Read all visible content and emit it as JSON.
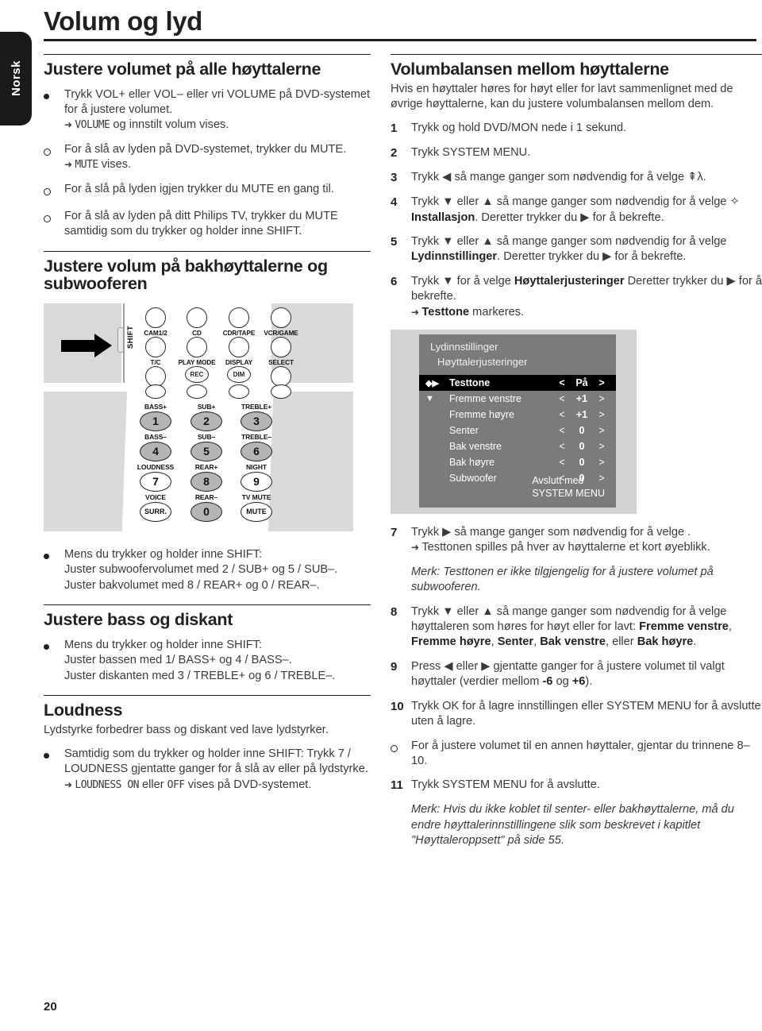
{
  "language_tab": "Norsk",
  "page_title": "Volum og lyd",
  "page_number": "20",
  "left_column": {
    "section1": {
      "heading": "Justere volumet på alle høyttalerne",
      "items": [
        {
          "marker": "filled",
          "text": "Trykk VOL+ eller VOL– eller vri VOLUME på DVD-systemet for å justere volumet.",
          "result": "VOLUME og innstilt volum vises.",
          "result_lcd": "VOLUME"
        },
        {
          "marker": "hollow",
          "text": "For å slå av lyden på DVD-systemet, trykker du MUTE.",
          "result": "MUTE vises.",
          "result_lcd": "MUTE"
        },
        {
          "marker": "hollow",
          "text": "For å slå på lyden igjen trykker du MUTE en gang til.",
          "result": "",
          "result_lcd": ""
        },
        {
          "marker": "hollow",
          "text": "For å slå av lyden på ditt Philips TV, trykker du MUTE samtidig som du trykker og holder inne SHIFT.",
          "result": "",
          "result_lcd": ""
        }
      ]
    },
    "section2": {
      "heading": "Justere volum på bakhøyttalerne og subwooferen",
      "bullet": {
        "line1": "Mens du trykker og holder inne SHIFT:",
        "line2": "Juster subwoofervolumet med 2 / SUB+ og 5 / SUB–.",
        "line3": "Juster bakvolumet med 8 / REAR+ og 0 / REAR–."
      }
    },
    "section3": {
      "heading": "Justere bass og diskant",
      "bullet": {
        "line1": "Mens du trykker og holder inne SHIFT:",
        "line2": "Juster bassen med 1/ BASS+ og 4 / BASS–.",
        "line3": "Juster diskanten med 3 / TREBLE+ og 6 / TREBLE–."
      }
    },
    "section4": {
      "heading": "Loudness",
      "lead": "Lydstyrke forbedrer bass og diskant ved lave lydstyrker.",
      "bullet_text": "Samtidig som du trykker og holder inne SHIFT: Trykk 7 / LOUDNESS gjentatte ganger for å slå av eller på lydstyrke.",
      "result_prefix": "",
      "result_lcd_on": "LOUDNESS ON",
      "result_mid": " eller ",
      "result_lcd_off": "OFF",
      "result_suffix": " vises på DVD-systemet."
    }
  },
  "remote": {
    "shift_label": "SHIFT",
    "source_buttons": [
      "CAM1/2",
      "CD",
      "CDR/TAPE",
      "VCR/GAME"
    ],
    "function_buttons": [
      "T/C",
      "PLAY MODE",
      "DISPLAY",
      "SELECT"
    ],
    "sub_buttons": [
      "REC",
      "DIM"
    ],
    "keypad": [
      {
        "label": "BASS+",
        "digit": "1",
        "shaded": true
      },
      {
        "label": "SUB+",
        "digit": "2",
        "shaded": true
      },
      {
        "label": "TREBLE+",
        "digit": "3",
        "shaded": true
      },
      {
        "label": "BASS–",
        "digit": "4",
        "shaded": true
      },
      {
        "label": "SUB–",
        "digit": "5",
        "shaded": true
      },
      {
        "label": "TREBLE–",
        "digit": "6",
        "shaded": true
      },
      {
        "label": "LOUDNESS",
        "digit": "7",
        "shaded": false
      },
      {
        "label": "REAR+",
        "digit": "8",
        "shaded": true
      },
      {
        "label": "NIGHT",
        "digit": "9",
        "shaded": false
      },
      {
        "label": "VOICE",
        "digit": "SURR.",
        "shaded": false
      },
      {
        "label": "REAR–",
        "digit": "0",
        "shaded": true
      },
      {
        "label": "TV MUTE",
        "digit": "MUTE",
        "shaded": false
      }
    ]
  },
  "right_column": {
    "heading": "Volumbalansen mellom høyttalerne",
    "lead": "Hvis en høyttaler høres for høyt eller for lavt sammenlignet med de øvrige høyttalerne, kan du justere volumbalansen mellom dem.",
    "steps": [
      {
        "num": "1",
        "text": "Trykk og hold DVD/MON nede i 1 sekund."
      },
      {
        "num": "2",
        "text": "Trykk SYSTEM MENU."
      },
      {
        "num": "3",
        "text": "Trykk ◀ så mange ganger som nødvendig for å velge ⇞λ."
      },
      {
        "num": "4",
        "text": "Trykk ▼ eller ▲ så mange ganger som nødvendig for å velge ✧ Installasjon. Deretter trykker du ▶ for å bekrefte.",
        "bold_part": "Installasjon"
      },
      {
        "num": "5",
        "text": "Trykk ▼ eller ▲ så mange ganger som nødvendig for å velge Lydinnstillinger. Deretter trykker du ▶ for å bekrefte.",
        "bold_part": "Lydinnstillinger"
      },
      {
        "num": "6",
        "text": "Trykk ▼ for å velge Høyttalerjusteringer Deretter trykker du ▶ for å bekrefte.",
        "bold_part": "Høyttalerjusteringer",
        "result": "Testtone markeres.",
        "result_bold": "Testtone"
      },
      {
        "num": "7",
        "text": "Trykk ▶ så mange ganger som nødvendig for å velge .",
        "result": "Testtonen spilles på hver av høyttalerne et kort øyeblikk.",
        "note": "Merk: Testtonen er ikke tilgjengelig for å justere volumet på subwooferen."
      },
      {
        "num": "8",
        "text": "Trykk ▼ eller ▲ så mange ganger som nødvendig for å velge høyttaleren som høres for høyt eller for lavt: Fremme venstre, Fremme høyre, Senter, Bak venstre, eller Bak høyre."
      },
      {
        "num": "9",
        "text": "Press ◀ eller ▶ gjentatte ganger for å justere volumet til valgt høyttaler (verdier mellom -6 og +6)."
      },
      {
        "num": "10",
        "text": "Trykk OK for å lagre innstillingen eller SYSTEM MENU for å avslutte uten å lagre."
      },
      {
        "num": "○",
        "text": "For å justere volumet til en annen høyttaler, gjentar du trinnene 8–10."
      },
      {
        "num": "11",
        "text": "Trykk SYSTEM MENU for å avslutte."
      }
    ],
    "final_note": "Merk: Hvis du ikke koblet til senter- eller bakhøyttalerne, må du endre høyttalerinnstillingene slik som beskrevet i kapitlet \"Høyttaleroppsett\" på side 55."
  },
  "osd": {
    "title1": "Lydinnstillinger",
    "title2": "Høyttalerjusteringer",
    "rows": [
      {
        "icon": "◆▶",
        "name": "Testtone",
        "left": "<",
        "value": "På",
        "right": ">",
        "highlighted": true
      },
      {
        "icon": "▼",
        "name": "Fremme venstre",
        "left": "<",
        "value": "+1",
        "right": ">",
        "highlighted": false
      },
      {
        "icon": "",
        "name": "Fremme høyre",
        "left": "<",
        "value": "+1",
        "right": ">",
        "highlighted": false
      },
      {
        "icon": "",
        "name": "Senter",
        "left": "<",
        "value": "0",
        "right": ">",
        "highlighted": false
      },
      {
        "icon": "",
        "name": "Bak venstre",
        "left": "<",
        "value": "0",
        "right": ">",
        "highlighted": false
      },
      {
        "icon": "",
        "name": "Bak høyre",
        "left": "<",
        "value": "0",
        "right": ">",
        "highlighted": false
      },
      {
        "icon": "",
        "name": "Subwoofer",
        "left": "<",
        "value": "0",
        "right": ">",
        "highlighted": false
      }
    ],
    "footer_line1": "Avslutt med",
    "footer_line2": "SYSTEM MENU"
  },
  "colors": {
    "ink": "#231f20",
    "body_text": "#3a3a3c",
    "osd_bg": "#7b7b7b",
    "osd_frame": "#d2d2d2",
    "remote_gray": "#d9d9d9",
    "key_shade": "#b5b5b5"
  }
}
